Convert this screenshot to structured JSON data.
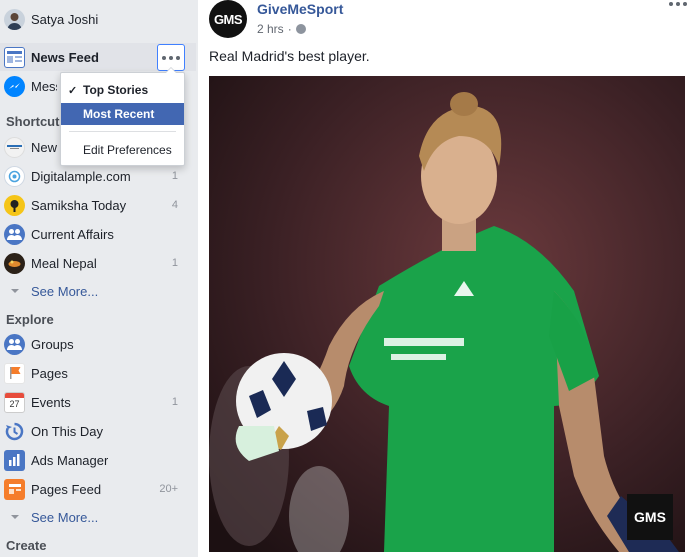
{
  "sidebar": {
    "profile": {
      "name": "Satya Joshi"
    },
    "news_feed": {
      "label": "News Feed"
    },
    "messenger": {
      "label": "Messenger"
    },
    "shortcuts_heading": "Shortcuts",
    "shortcuts": [
      {
        "label": "NewT",
        "count": ""
      },
      {
        "label": "Digitalample.com",
        "count": "1"
      },
      {
        "label": "Samiksha Today",
        "count": "4"
      },
      {
        "label": "Current Affairs",
        "count": ""
      },
      {
        "label": "Meal Nepal",
        "count": "1"
      }
    ],
    "see_more_1": "See More...",
    "explore_heading": "Explore",
    "explore": [
      {
        "label": "Groups",
        "count": "",
        "icon": "groups-icon"
      },
      {
        "label": "Pages",
        "count": "",
        "icon": "flag-icon"
      },
      {
        "label": "Events",
        "count": "1",
        "icon": "calendar-icon",
        "icon_text": "27"
      },
      {
        "label": "On This Day",
        "count": "",
        "icon": "clock-icon"
      },
      {
        "label": "Ads Manager",
        "count": "",
        "icon": "bar-chart-icon"
      },
      {
        "label": "Pages Feed",
        "count": "20+",
        "icon": "pages-feed-icon"
      }
    ],
    "see_more_2": "See More...",
    "create_heading": "Create"
  },
  "menu": {
    "items": [
      "Top Stories",
      "Most Recent",
      "Edit Preferences"
    ],
    "checked": "Top Stories",
    "selected": "Most Recent",
    "check_glyph": "✓"
  },
  "post": {
    "page_name": "GiveMeSport",
    "avatar_text": "GMS",
    "time": "2 hrs",
    "separator": "·",
    "caption": "Real Madrid's best player.",
    "watermark": "GMS"
  },
  "colors": {
    "link": "#365899",
    "highlight": "#4267b2",
    "jersey": "#1aa34a"
  }
}
